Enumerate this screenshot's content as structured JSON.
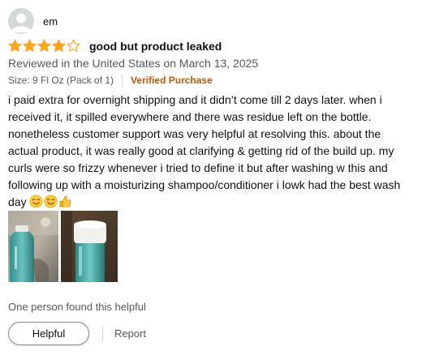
{
  "profile": {
    "name": "em",
    "avatar_icon": "default-user-avatar-icon"
  },
  "review": {
    "rating": 4,
    "rating_max": 5,
    "star_color": "#ffa41c",
    "title": "good but product leaked",
    "date_line": "Reviewed in the United States on March 13, 2025",
    "format_strip": "Size: 9 Fl Oz (Pack of 1)",
    "verified_label": "Verified Purchase",
    "verified_color": "#c45500",
    "body": "i paid extra for overnight shipping and it didn’t come till 2 days later. when i received it, it spilled everywhere and there was residue left on the bottle. nonetheless customer support was very helpful at resolving this. about the actual product, it was really good at clarifying & getting rid of the build up. my curls were so frizzy whenever i tried to define it but after washing w this and following up with a moisturizing shampoo/conditioner i lowk had the best wash day",
    "emojis": [
      "smiling-face-icon",
      "smiling-face-icon",
      "thumbs-up-icon"
    ],
    "images": [
      {
        "name": "review-image-bottle-side"
      },
      {
        "name": "review-image-bottle-top"
      }
    ]
  },
  "footer": {
    "helpful_count": "One person found this helpful",
    "helpful_button": "Helpful",
    "report_link": "Report"
  }
}
